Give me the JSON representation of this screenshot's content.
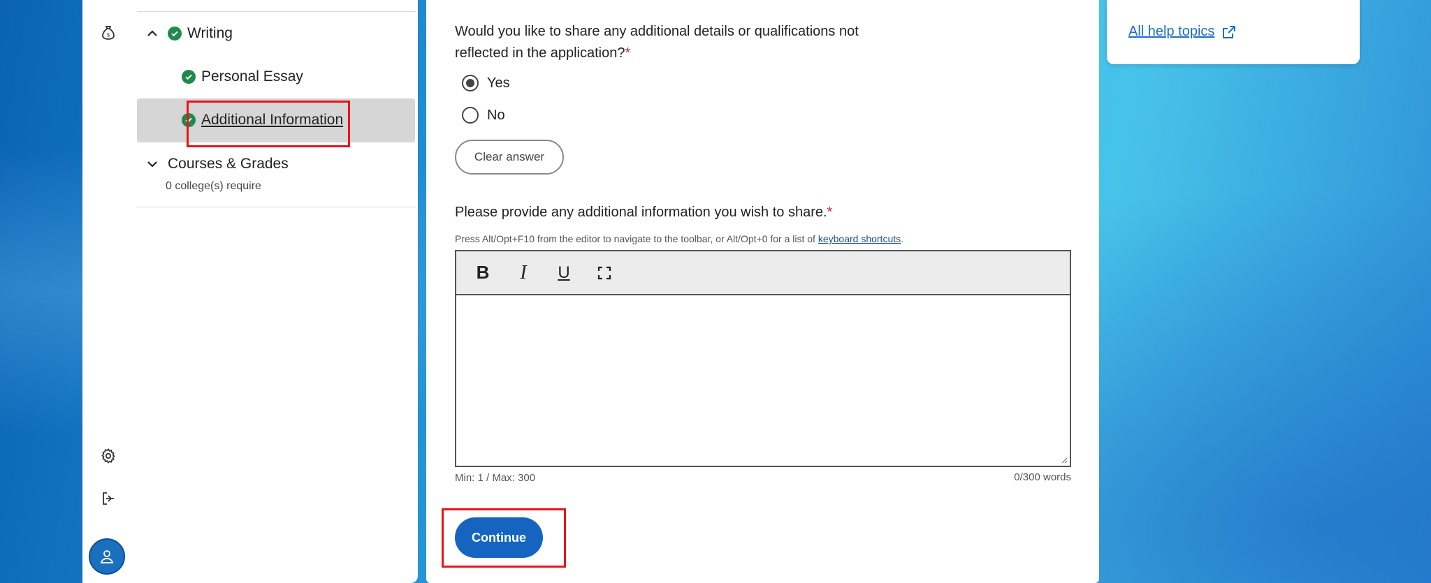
{
  "nav": {
    "writing_label": "Writing",
    "personal_essay_label": "Personal Essay",
    "additional_info_label": "Additional Information",
    "courses_label": "Courses & Grades",
    "courses_sub": "0 college(s) require"
  },
  "form": {
    "question1": "Would you like to share any additional details or qualifications not reflected in the application?",
    "required_mark": "*",
    "option_yes": "Yes",
    "option_no": "No",
    "selected": "Yes",
    "clear_label": "Clear answer",
    "question2": "Please provide any additional information you wish to share.",
    "hint_prefix": "Press Alt/Opt+F10 from the editor to navigate to the toolbar, or Alt/Opt+0 for a list of ",
    "hint_link": "keyboard shortcuts",
    "hint_suffix": ".",
    "editor_value": "",
    "toolbar": {
      "bold": "B",
      "italic": "I",
      "underline": "U"
    },
    "minmax": "Min: 1 / Max: 300",
    "wordcount": "0/300 words",
    "continue_label": "Continue"
  },
  "help": {
    "link_label": "All help topics"
  },
  "colors": {
    "accent": "#1565c0",
    "check": "#1f8a4c",
    "required": "#d0202a",
    "highlight": "#e8141b"
  }
}
